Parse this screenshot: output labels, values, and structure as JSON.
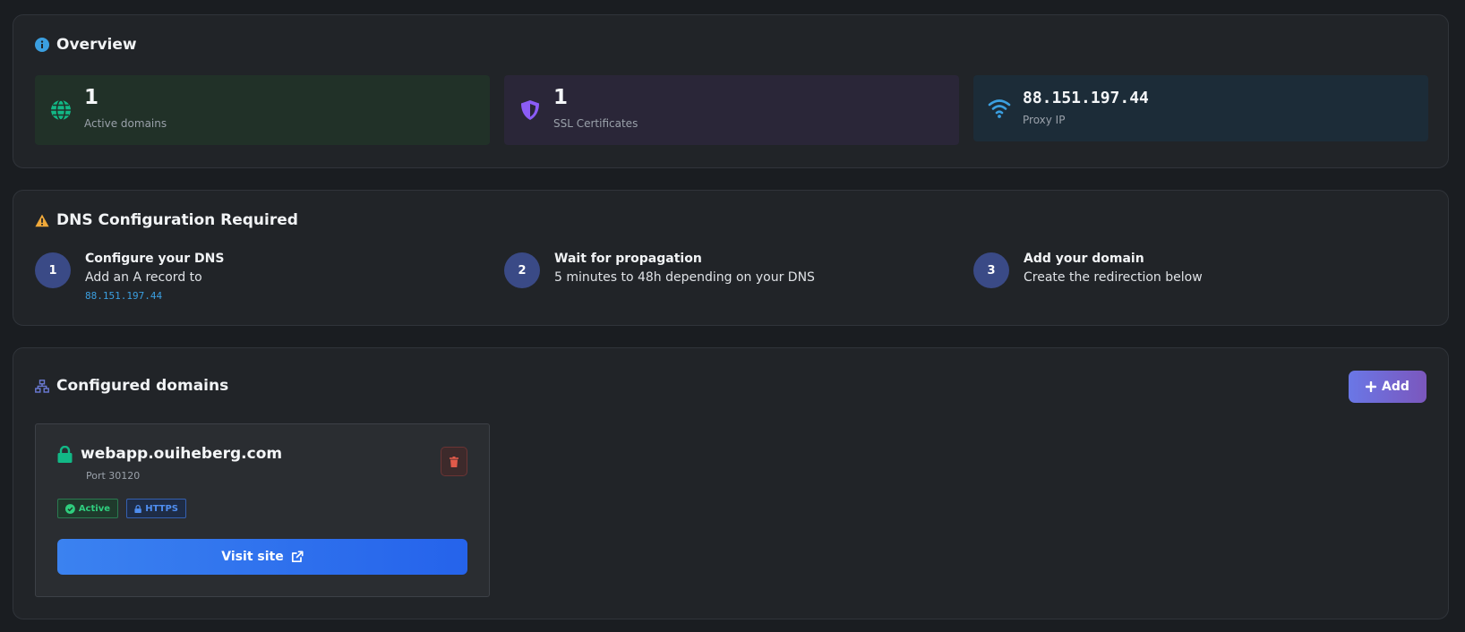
{
  "colors": {
    "page_bg": "#1a1d21",
    "card_bg": "#212428",
    "accent_green": "#12b886",
    "accent_purple": "#8b5cf6",
    "accent_blue": "#3b9fe0",
    "warning": "#f0a93a",
    "danger": "#e05a4a"
  },
  "overview": {
    "title": "Overview",
    "icon": "info-icon",
    "stats": [
      {
        "value": "1",
        "label": "Active domains",
        "icon": "globe-icon"
      },
      {
        "value": "1",
        "label": "SSL Certificates",
        "icon": "shield-icon"
      },
      {
        "value": "88.151.197.44",
        "label": "Proxy IP",
        "icon": "wifi-icon"
      }
    ]
  },
  "dns": {
    "title": "DNS Configuration Required",
    "icon": "warning-icon",
    "steps": [
      {
        "number": "1",
        "title": "Configure your DNS",
        "description": "Add an A record to",
        "ip": "88.151.197.44"
      },
      {
        "number": "2",
        "title": "Wait for propagation",
        "description": "5 minutes to 48h depending on your DNS"
      },
      {
        "number": "3",
        "title": "Add your domain",
        "description": "Create the redirection below"
      }
    ]
  },
  "domains": {
    "title": "Configured domains",
    "icon": "sitemap-icon",
    "add_label": "Add",
    "items": [
      {
        "domain": "webapp.ouiheberg.com",
        "port": "Port 30120",
        "status_badge": "Active",
        "protocol_badge": "HTTPS",
        "visit_label": "Visit site"
      }
    ]
  }
}
